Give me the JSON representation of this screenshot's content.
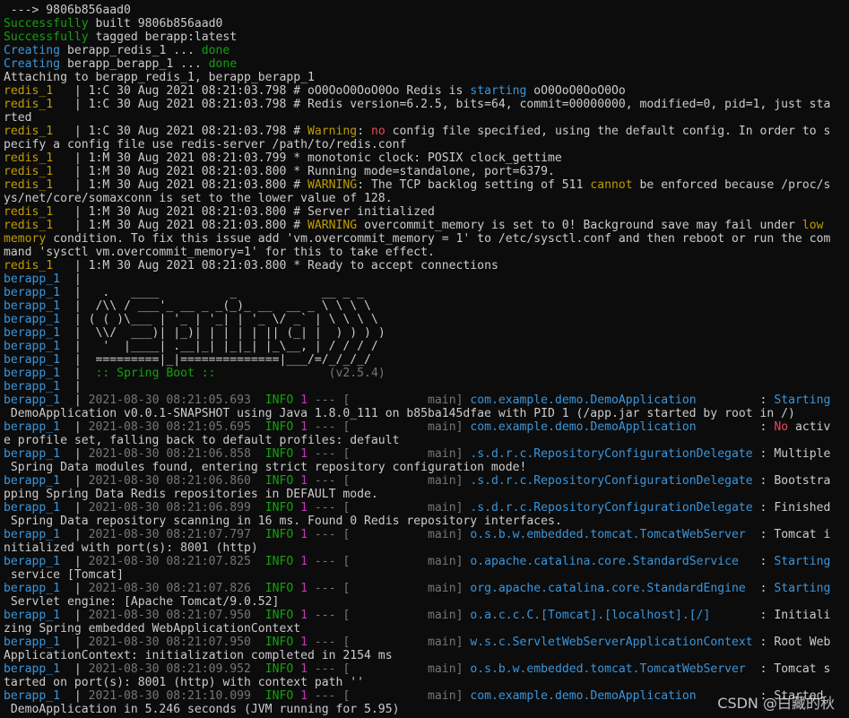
{
  "colors": {
    "default": "#cccccc",
    "green": "#13a10e",
    "cyan": "#3a96dd",
    "yellow": "#c19c00",
    "red": "#e74856",
    "magenta": "#c239b3",
    "dim": "#767676"
  },
  "watermark": "CSDN @白藏的秋",
  "lines": [
    [
      [
        " ---> 9806b856aad0",
        "default"
      ]
    ],
    [
      [
        "Successfully",
        "green"
      ],
      [
        " built 9806b856aad0",
        "default"
      ]
    ],
    [
      [
        "Successfully",
        "green"
      ],
      [
        " tagged berapp:latest",
        "default"
      ]
    ],
    [
      [
        "Creating",
        "cyan"
      ],
      [
        " berapp_redis_1 ... ",
        "default"
      ],
      [
        "done",
        "green"
      ]
    ],
    [
      [
        "Creating",
        "cyan"
      ],
      [
        " berapp_berapp_1 ... ",
        "default"
      ],
      [
        "done",
        "green"
      ]
    ],
    [
      [
        "Attaching to berapp_redis_1, berapp_berapp_1",
        "default"
      ]
    ],
    [
      [
        "redis_1   ",
        "yellow"
      ],
      [
        "| 1:C 30 Aug 2021 08:21:03.798 # oO0OoO0OoO0Oo Redis is ",
        "default"
      ],
      [
        "starting",
        "cyan"
      ],
      [
        " oO0OoO0OoO0Oo",
        "default"
      ]
    ],
    [
      [
        "redis_1   ",
        "yellow"
      ],
      [
        "| 1:C 30 Aug 2021 08:21:03.798 # Redis version=6.2.5, bits=64, commit=00000000, modified=0, pid=1, just sta",
        "default"
      ]
    ],
    [
      [
        "rted",
        "default"
      ]
    ],
    [
      [
        "redis_1   ",
        "yellow"
      ],
      [
        "| 1:C 30 Aug 2021 08:21:03.798 # ",
        "default"
      ],
      [
        "Warning",
        "yellow"
      ],
      [
        ": ",
        "default"
      ],
      [
        "no",
        "red"
      ],
      [
        " config file specified, using the default config. In order to s",
        "default"
      ]
    ],
    [
      [
        "pecify a config file use redis-server /path/to/redis.conf",
        "default"
      ]
    ],
    [
      [
        "redis_1   ",
        "yellow"
      ],
      [
        "| 1:M 30 Aug 2021 08:21:03.799 * monotonic clock: POSIX clock_gettime",
        "default"
      ]
    ],
    [
      [
        "redis_1   ",
        "yellow"
      ],
      [
        "| 1:M 30 Aug 2021 08:21:03.800 * Running mode=standalone, port=6379.",
        "default"
      ]
    ],
    [
      [
        "redis_1   ",
        "yellow"
      ],
      [
        "| 1:M 30 Aug 2021 08:21:03.800 # ",
        "default"
      ],
      [
        "WARNING",
        "yellow"
      ],
      [
        ": The TCP backlog setting of 511 ",
        "default"
      ],
      [
        "cannot",
        "yellow"
      ],
      [
        " be enforced because /proc/s",
        "default"
      ]
    ],
    [
      [
        "ys/net/core/somaxconn is set to the lower value of 128.",
        "default"
      ]
    ],
    [
      [
        "redis_1   ",
        "yellow"
      ],
      [
        "| 1:M 30 Aug 2021 08:21:03.800 # Server initialized",
        "default"
      ]
    ],
    [
      [
        "redis_1   ",
        "yellow"
      ],
      [
        "| 1:M 30 Aug 2021 08:21:03.800 # ",
        "default"
      ],
      [
        "WARNING",
        "yellow"
      ],
      [
        " overcommit_memory is set to 0! Background save may fail under ",
        "default"
      ],
      [
        "low",
        "yellow"
      ]
    ],
    [
      [
        "memory",
        "yellow"
      ],
      [
        " condition. To fix this issue add 'vm.overcommit_memory = 1' to /etc/sysctl.conf and then reboot or run the com",
        "default"
      ]
    ],
    [
      [
        "mand 'sysctl vm.overcommit_memory=1' for this to take effect.",
        "default"
      ]
    ],
    [
      [
        "redis_1   ",
        "yellow"
      ],
      [
        "| 1:M 30 Aug 2021 08:21:03.800 * Ready to accept connections",
        "default"
      ]
    ],
    [
      [
        "berapp_1  ",
        "cyan"
      ],
      [
        "|",
        "default"
      ]
    ],
    [
      [
        "berapp_1  ",
        "cyan"
      ],
      [
        "|   .   ____          _            __ _ _",
        "default"
      ]
    ],
    [
      [
        "berapp_1  ",
        "cyan"
      ],
      [
        "|  /\\\\ / ___'_ __ _ _(_)_ __  __ _ \\ \\ \\ \\",
        "default"
      ]
    ],
    [
      [
        "berapp_1  ",
        "cyan"
      ],
      [
        "| ( ( )\\___ | '_ | '_| | '_ \\/ _` | \\ \\ \\ \\",
        "default"
      ]
    ],
    [
      [
        "berapp_1  ",
        "cyan"
      ],
      [
        "|  \\\\/  ___)| |_)| | | | | || (_| |  ) ) ) )",
        "default"
      ]
    ],
    [
      [
        "berapp_1  ",
        "cyan"
      ],
      [
        "|   '  |____| .__|_| |_|_| |_\\__, | / / / /",
        "default"
      ]
    ],
    [
      [
        "berapp_1  ",
        "cyan"
      ],
      [
        "|  =========|_|==============|___/=/_/_/_/",
        "default"
      ]
    ],
    [
      [
        "berapp_1  ",
        "cyan"
      ],
      [
        "|  ",
        "default"
      ],
      [
        ":: Spring Boot ::",
        "green"
      ],
      [
        "                (v2.5.4)",
        "dim"
      ]
    ],
    [
      [
        "berapp_1  ",
        "cyan"
      ],
      [
        "|",
        "default"
      ]
    ],
    [
      [
        "berapp_1  ",
        "cyan"
      ],
      [
        "| ",
        "default"
      ],
      [
        "2021-08-30 08:21:05.693  ",
        "dim"
      ],
      [
        "INFO",
        "green"
      ],
      [
        " ",
        "default"
      ],
      [
        "1",
        "magenta"
      ],
      [
        " --- [           main] ",
        "dim"
      ],
      [
        "com.example.demo.DemoApplication",
        "cyan"
      ],
      [
        "         : ",
        "default"
      ],
      [
        "Starting",
        "cyan"
      ]
    ],
    [
      [
        " DemoApplication v0.0.1-SNAPSHOT using Java 1.8.0_111 on b85ba145dfae with PID 1 (/app.jar started by root in /)",
        "default"
      ]
    ],
    [
      [
        "berapp_1  ",
        "cyan"
      ],
      [
        "| ",
        "default"
      ],
      [
        "2021-08-30 08:21:05.695  ",
        "dim"
      ],
      [
        "INFO",
        "green"
      ],
      [
        " ",
        "default"
      ],
      [
        "1",
        "magenta"
      ],
      [
        " --- [           main] ",
        "dim"
      ],
      [
        "com.example.demo.DemoApplication",
        "cyan"
      ],
      [
        "         : ",
        "default"
      ],
      [
        "No",
        "red"
      ],
      [
        " activ",
        "default"
      ]
    ],
    [
      [
        "e profile set, falling back to default profiles: default",
        "default"
      ]
    ],
    [
      [
        "berapp_1  ",
        "cyan"
      ],
      [
        "| ",
        "default"
      ],
      [
        "2021-08-30 08:21:06.858  ",
        "dim"
      ],
      [
        "INFO",
        "green"
      ],
      [
        " ",
        "default"
      ],
      [
        "1",
        "magenta"
      ],
      [
        " --- [           main] ",
        "dim"
      ],
      [
        ".s.d.r.c.RepositoryConfigurationDelegate",
        "cyan"
      ],
      [
        " : Multiple",
        "default"
      ]
    ],
    [
      [
        " Spring Data modules found, entering strict repository configuration mode!",
        "default"
      ]
    ],
    [
      [
        "berapp_1  ",
        "cyan"
      ],
      [
        "| ",
        "default"
      ],
      [
        "2021-08-30 08:21:06.860  ",
        "dim"
      ],
      [
        "INFO",
        "green"
      ],
      [
        " ",
        "default"
      ],
      [
        "1",
        "magenta"
      ],
      [
        " --- [           main] ",
        "dim"
      ],
      [
        ".s.d.r.c.RepositoryConfigurationDelegate",
        "cyan"
      ],
      [
        " : Bootstra",
        "default"
      ]
    ],
    [
      [
        "pping Spring Data Redis repositories in DEFAULT mode.",
        "default"
      ]
    ],
    [
      [
        "berapp_1  ",
        "cyan"
      ],
      [
        "| ",
        "default"
      ],
      [
        "2021-08-30 08:21:06.899  ",
        "dim"
      ],
      [
        "INFO",
        "green"
      ],
      [
        " ",
        "default"
      ],
      [
        "1",
        "magenta"
      ],
      [
        " --- [           main] ",
        "dim"
      ],
      [
        ".s.d.r.c.RepositoryConfigurationDelegate",
        "cyan"
      ],
      [
        " : Finished",
        "default"
      ]
    ],
    [
      [
        " Spring Data repository scanning in 16 ms. Found 0 Redis repository interfaces.",
        "default"
      ]
    ],
    [
      [
        "berapp_1  ",
        "cyan"
      ],
      [
        "| ",
        "default"
      ],
      [
        "2021-08-30 08:21:07.797  ",
        "dim"
      ],
      [
        "INFO",
        "green"
      ],
      [
        " ",
        "default"
      ],
      [
        "1",
        "magenta"
      ],
      [
        " --- [           main] ",
        "dim"
      ],
      [
        "o.s.b.w.embedded.tomcat.TomcatWebServer",
        "cyan"
      ],
      [
        "  : Tomcat i",
        "default"
      ]
    ],
    [
      [
        "nitialized with port(s): 8001 (http)",
        "default"
      ]
    ],
    [
      [
        "berapp_1  ",
        "cyan"
      ],
      [
        "| ",
        "default"
      ],
      [
        "2021-08-30 08:21:07.825  ",
        "dim"
      ],
      [
        "INFO",
        "green"
      ],
      [
        " ",
        "default"
      ],
      [
        "1",
        "magenta"
      ],
      [
        " --- [           main] ",
        "dim"
      ],
      [
        "o.apache.catalina.core.StandardService",
        "cyan"
      ],
      [
        "   : ",
        "default"
      ],
      [
        "Starting",
        "cyan"
      ]
    ],
    [
      [
        " service [Tomcat]",
        "default"
      ]
    ],
    [
      [
        "berapp_1  ",
        "cyan"
      ],
      [
        "| ",
        "default"
      ],
      [
        "2021-08-30 08:21:07.826  ",
        "dim"
      ],
      [
        "INFO",
        "green"
      ],
      [
        " ",
        "default"
      ],
      [
        "1",
        "magenta"
      ],
      [
        " --- [           main] ",
        "dim"
      ],
      [
        "org.apache.catalina.core.StandardEngine",
        "cyan"
      ],
      [
        "  : ",
        "default"
      ],
      [
        "Starting",
        "cyan"
      ]
    ],
    [
      [
        " Servlet engine: [Apache Tomcat/9.0.52]",
        "default"
      ]
    ],
    [
      [
        "berapp_1  ",
        "cyan"
      ],
      [
        "| ",
        "default"
      ],
      [
        "2021-08-30 08:21:07.950  ",
        "dim"
      ],
      [
        "INFO",
        "green"
      ],
      [
        " ",
        "default"
      ],
      [
        "1",
        "magenta"
      ],
      [
        " --- [           main] ",
        "dim"
      ],
      [
        "o.a.c.c.C.[Tomcat].[localhost].[/]",
        "cyan"
      ],
      [
        "       : Initiali",
        "default"
      ]
    ],
    [
      [
        "zing Spring embedded WebApplicationContext",
        "default"
      ]
    ],
    [
      [
        "berapp_1  ",
        "cyan"
      ],
      [
        "| ",
        "default"
      ],
      [
        "2021-08-30 08:21:07.950  ",
        "dim"
      ],
      [
        "INFO",
        "green"
      ],
      [
        " ",
        "default"
      ],
      [
        "1",
        "magenta"
      ],
      [
        " --- [           main] ",
        "dim"
      ],
      [
        "w.s.c.ServletWebServerApplicationContext",
        "cyan"
      ],
      [
        " : Root Web",
        "default"
      ]
    ],
    [
      [
        "ApplicationContext: initialization completed in 2154 ms",
        "default"
      ]
    ],
    [
      [
        "berapp_1  ",
        "cyan"
      ],
      [
        "| ",
        "default"
      ],
      [
        "2021-08-30 08:21:09.952  ",
        "dim"
      ],
      [
        "INFO",
        "green"
      ],
      [
        " ",
        "default"
      ],
      [
        "1",
        "magenta"
      ],
      [
        " --- [           main] ",
        "dim"
      ],
      [
        "o.s.b.w.embedded.tomcat.TomcatWebServer",
        "cyan"
      ],
      [
        "  : Tomcat s",
        "default"
      ]
    ],
    [
      [
        "tarted on port(s): 8001 (http) with context path ''",
        "default"
      ]
    ],
    [
      [
        "berapp_1  ",
        "cyan"
      ],
      [
        "| ",
        "default"
      ],
      [
        "2021-08-30 08:21:10.099  ",
        "dim"
      ],
      [
        "INFO",
        "green"
      ],
      [
        " ",
        "default"
      ],
      [
        "1",
        "magenta"
      ],
      [
        " --- [           main] ",
        "dim"
      ],
      [
        "com.example.demo.DemoApplication",
        "cyan"
      ],
      [
        "         : Started",
        "default"
      ]
    ],
    [
      [
        " DemoApplication in 5.246 seconds (JVM running for 5.95)",
        "default"
      ]
    ]
  ]
}
